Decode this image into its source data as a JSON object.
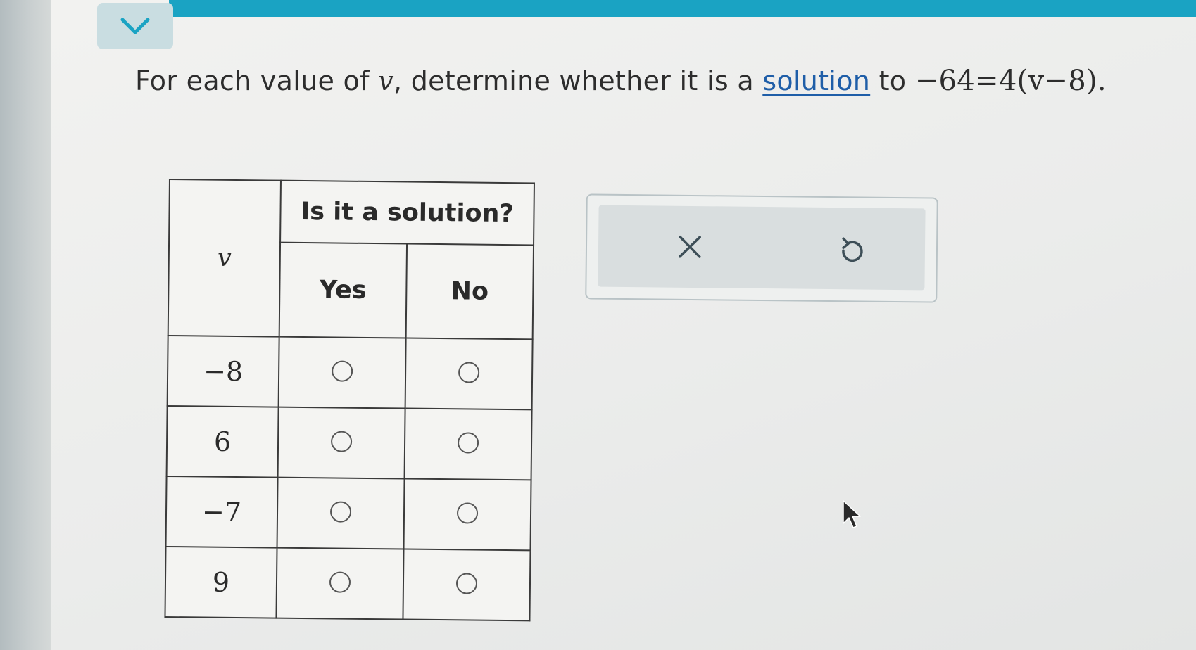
{
  "question": {
    "prefix": "For each value of ",
    "variable": "v",
    "middle": ", determine whether it is a ",
    "link_text": "solution",
    "suffix": " to ",
    "equation": "−64=4(v−8)."
  },
  "table": {
    "var_header": "v",
    "solution_header": "Is it a solution?",
    "yes_header": "Yes",
    "no_header": "No",
    "rows": [
      {
        "value": "−8"
      },
      {
        "value": "6"
      },
      {
        "value": "−7"
      },
      {
        "value": "9"
      }
    ]
  },
  "icons": {
    "collapse": "chevron-down-icon",
    "clear": "close-icon",
    "undo": "undo-icon",
    "pointer": "mouse-pointer-icon"
  },
  "colors": {
    "accent": "#1aa3c3",
    "link": "#1f5ea8"
  }
}
